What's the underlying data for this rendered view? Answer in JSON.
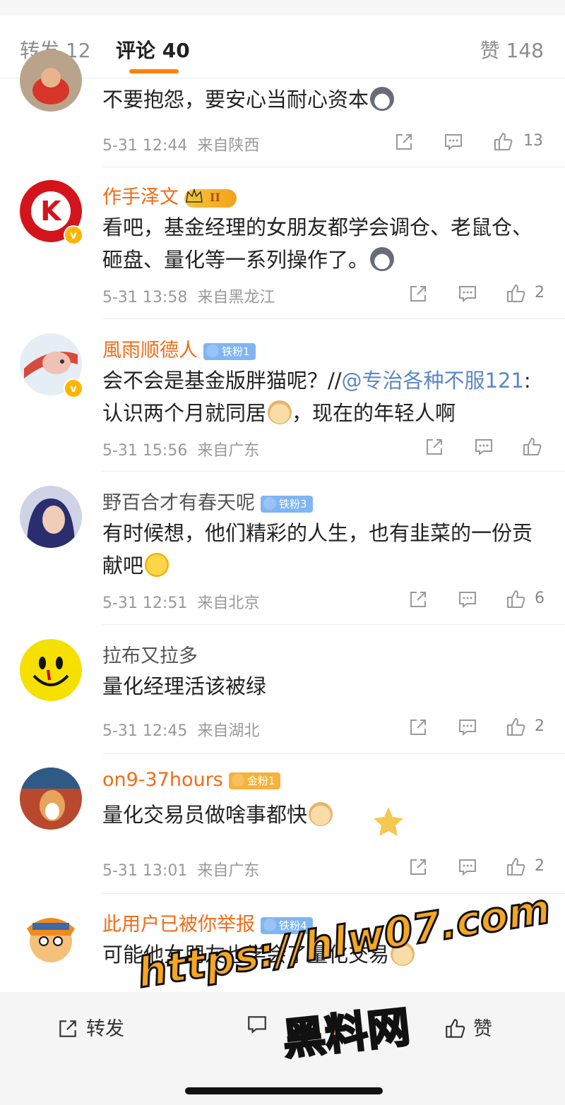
{
  "tabs": {
    "repost": "转发 12",
    "comment": "评论 40",
    "like": "赞 148"
  },
  "comments": [
    {
      "name": "",
      "text": "不要抱怨，要安心当耐心资本",
      "emoji": "husky",
      "time": "5-31 12:44",
      "location": "来自陕西",
      "likes": "13"
    },
    {
      "name": "作手泽文",
      "badge": "II",
      "text": "看吧，基金经理的女朋友都学会调仓、老鼠仓、砸盘、量化等一系列操作了。",
      "emoji": "husky",
      "time": "5-31 13:58",
      "location": "来自黑龙江",
      "likes": "2"
    },
    {
      "name": "風雨顺德人",
      "badge": "铁粉1",
      "text_pre": "会不会是基金版胖猫呢？//",
      "mention": "@专治各种不服121",
      "text_post": ":认识两个月就同居",
      "text_post2": "，现在的年轻人啊",
      "emoji": "doge",
      "time": "5-31 15:56",
      "location": "来自广东",
      "likes": ""
    },
    {
      "name": "野百合才有春天呢",
      "badge": "铁粉3",
      "text": "有时候想，他们精彩的人生，也有韭菜的一份贡献吧",
      "emoji": "laugh",
      "time": "5-31 12:51",
      "location": "来自北京",
      "likes": "6"
    },
    {
      "name": "拉布又拉多",
      "text": "量化经理活该被绿",
      "time": "5-31 12:45",
      "location": "来自湖北",
      "likes": "2"
    },
    {
      "name": "on9-37hours",
      "badge": "金粉1",
      "text": "量化交易员做啥事都快",
      "emoji": "doge",
      "time": "5-31 13:01",
      "location": "来自广东",
      "likes": "2"
    },
    {
      "name": "此用户已被你举报",
      "badge": "铁粉4",
      "text": "可能他女朋友也学会了量化交易",
      "emoji": "doge"
    }
  ],
  "bottom_bar": {
    "repost": "转发",
    "comment": "",
    "like": "赞"
  },
  "watermark": {
    "url": "https://hlw07.com",
    "site": "黑料网"
  },
  "colors": {
    "accent": "#ff8200",
    "username": "#f26b15",
    "mention": "#5b87c6"
  }
}
